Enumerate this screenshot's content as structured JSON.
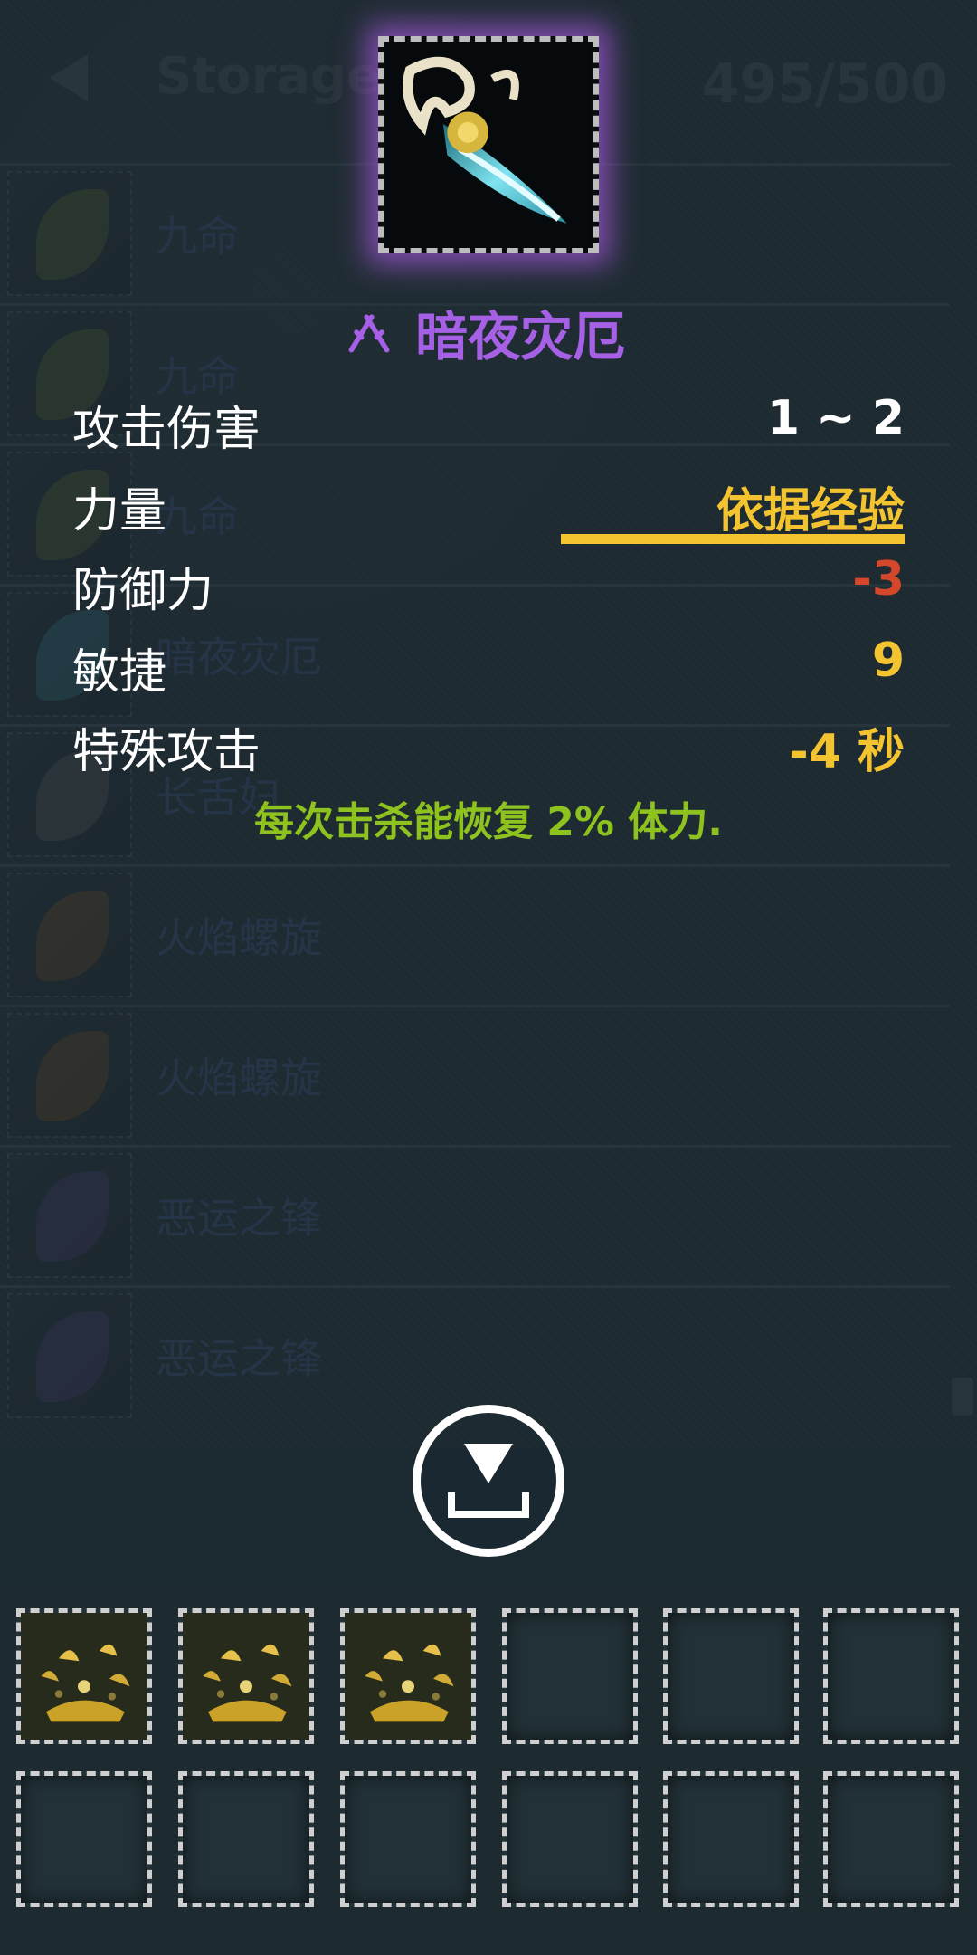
{
  "storage": {
    "title": "Storage",
    "capacity": "495/500",
    "items": [
      {
        "name": "九命",
        "tint": "#6b7c3a"
      },
      {
        "name": "九命",
        "tint": "#6b7c3a"
      },
      {
        "name": "九命",
        "tint": "#6b7c3a"
      },
      {
        "name": "暗夜灾厄",
        "tint": "#3f8fa0"
      },
      {
        "name": "长舌妇",
        "tint": "#6d6d6d"
      },
      {
        "name": "火焰螺旋",
        "tint": "#8a5a2e"
      },
      {
        "name": "火焰螺旋",
        "tint": "#8a5a2e"
      },
      {
        "name": "恶运之锋",
        "tint": "#5a4a8a"
      },
      {
        "name": "恶运之锋",
        "tint": "#5a4a8a"
      }
    ]
  },
  "tooltip": {
    "name": "暗夜灾厄",
    "name_color": "#a660e6",
    "icon": "dagger-icon",
    "stats": [
      {
        "label": "攻击伤害",
        "value": "1 ~ 2",
        "color": "#ffffff"
      },
      {
        "label": "力量",
        "value": "依据经验",
        "color": "#f4c430"
      },
      {
        "label": "防御力",
        "value": "-3",
        "color": "#d4472a"
      },
      {
        "label": "敏捷",
        "value": "9",
        "color": "#f4c430"
      },
      {
        "label": "特殊攻击",
        "value": "-4 秒",
        "color": "#f4c430"
      }
    ],
    "effect": "每次击杀能恢复 2% 体力.",
    "effect_color": "#8ec21e"
  },
  "actions": {
    "download_icon": "download-icon"
  },
  "inventory": {
    "slots": [
      {
        "filled": true,
        "item": "gold-pile"
      },
      {
        "filled": true,
        "item": "gold-pile"
      },
      {
        "filled": true,
        "item": "gold-pile"
      },
      {
        "filled": false
      },
      {
        "filled": false
      },
      {
        "filled": false
      },
      {
        "filled": false
      },
      {
        "filled": false
      },
      {
        "filled": false
      },
      {
        "filled": false
      },
      {
        "filled": false
      },
      {
        "filled": false
      }
    ]
  }
}
